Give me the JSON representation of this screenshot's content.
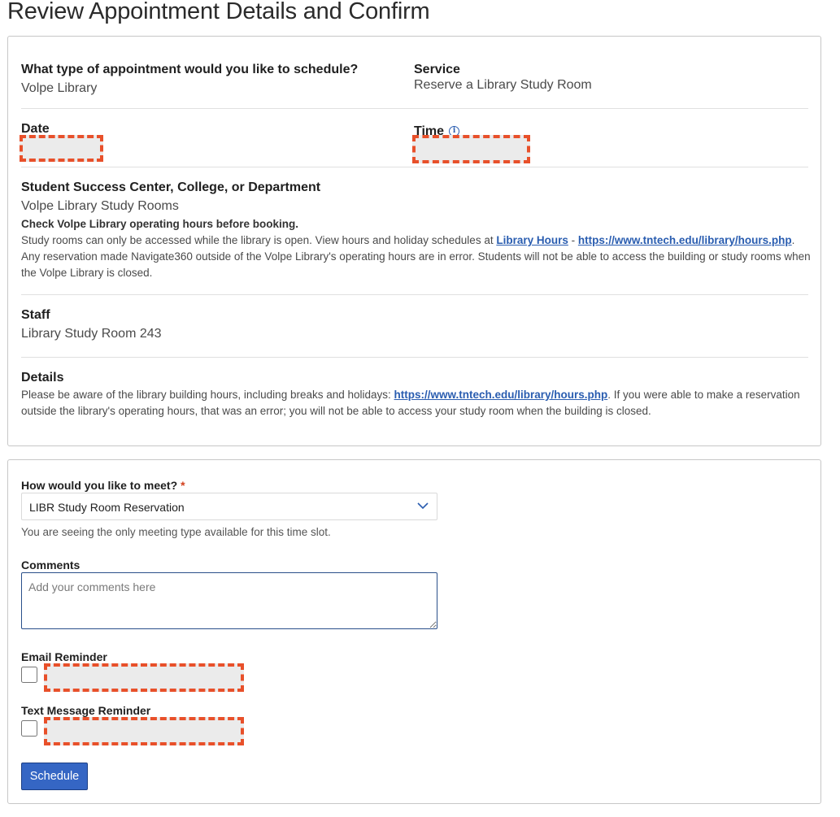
{
  "page": {
    "title": "Review Appointment Details and Confirm"
  },
  "details": {
    "appointment_type": {
      "label": "What type of appointment would you like to schedule?",
      "value": "Volpe Library"
    },
    "service": {
      "label": "Service",
      "value": "Reserve a Library Study Room"
    },
    "date": {
      "label": "Date"
    },
    "time": {
      "label": "Time",
      "info_icon": "info-icon"
    },
    "location": {
      "label": "Student Success Center, College, or Department",
      "value": "Volpe Library Study Rooms",
      "notice": "Check Volpe Library operating hours before booking.",
      "text_1": "Study rooms can only be accessed while the library is open. View hours and holiday schedules at ",
      "link_1": "Library Hours",
      "sep": " - ",
      "link_2": "https://www.tntech.edu/library/hours.php",
      "text_2": ".",
      "text_3": "Any reservation made Navigate360 outside of the Volpe Library's operating hours are in error. Students will not be able to access the building or study rooms when the Volpe Library is closed."
    },
    "staff": {
      "label": "Staff",
      "value": "Library Study Room 243"
    },
    "info": {
      "label": "Details",
      "text_1": "Please be aware of the library building hours, including breaks and holidays: ",
      "link": "https://www.tntech.edu/library/hours.php",
      "text_2": ". If you were able to make a reservation outside the library's operating hours, that was an error; you will not be able to access your study room when the building is closed."
    }
  },
  "form": {
    "meet": {
      "label": "How would you like to meet?",
      "required_mark": "*",
      "selected": "LIBR Study Room Reservation",
      "helper": "You are seeing the only meeting type available for this time slot."
    },
    "comments": {
      "label": "Comments",
      "placeholder": "Add your comments here"
    },
    "email_reminder": {
      "label": "Email Reminder"
    },
    "text_reminder": {
      "label": "Text Message Reminder"
    },
    "submit_label": "Schedule"
  },
  "colors": {
    "accent": "#3566c4",
    "link": "#2a5db0",
    "redaction": "#e8502a",
    "required": "#d2401d"
  }
}
